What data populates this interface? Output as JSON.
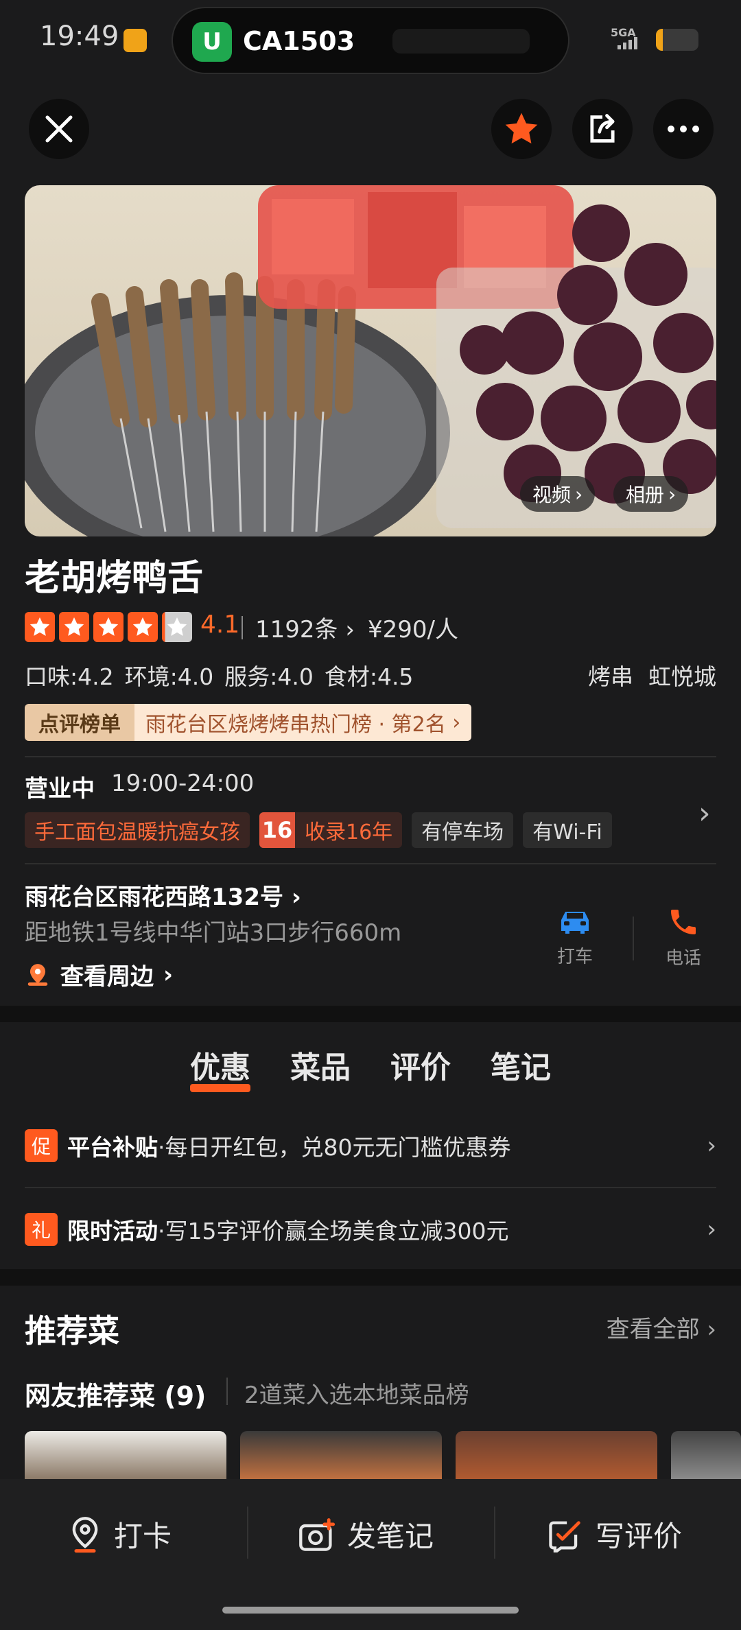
{
  "status_bar": {
    "time": "19:49",
    "signal": "5GA"
  },
  "dynamic_island": {
    "app_icon_glyph": "U",
    "text": "CA1503"
  },
  "hero": {
    "video_label": "视频",
    "album_label": "相册"
  },
  "shop": {
    "name": "老胡烤鸭舌",
    "rating": 4.1,
    "rating_text": "4.1",
    "review_count": "1192条",
    "price_per_person": "¥290/人",
    "scores": [
      "口味:4.2",
      "环境:4.0",
      "服务:4.0",
      "食材:4.5"
    ],
    "categories": [
      "烤串",
      "虹悦城"
    ],
    "ranking_tag": "点评榜单",
    "ranking_text": "雨花台区烧烤烤串热门榜 · 第2名"
  },
  "hours": {
    "status": "营业中",
    "time": "19:00-24:00"
  },
  "tags": {
    "charity": "手工面包温暖抗癌女孩",
    "years_badge": "16",
    "years_text": "收录16年",
    "parking": "有停车场",
    "wifi": "有Wi-Fi"
  },
  "location": {
    "address": "雨花台区雨花西路132号",
    "subway": "距地铁1号线中华门站3口步行660m",
    "nearby": "查看周边",
    "taxi_label": "打车",
    "phone_label": "电话"
  },
  "tabs": [
    "优惠",
    "菜品",
    "评价",
    "笔记"
  ],
  "promos": [
    {
      "icon": "促",
      "title": "平台补贴",
      "text": "·每日开红包，兑80元无门槛优惠券"
    },
    {
      "icon": "礼",
      "title": "限时活动",
      "text": "·写15字评价赢全场美食立减300元"
    }
  ],
  "recommend": {
    "title": "推荐菜",
    "see_all": "查看全部",
    "subtitle": "网友推荐菜 (9)",
    "subtitle2": "2道菜入选本地菜品榜"
  },
  "bottom_bar": {
    "checkin": "打卡",
    "post_note": "发笔记",
    "write_review": "写评价"
  },
  "colors": {
    "accent": "#ff5a1f",
    "background": "#1b1b1c"
  }
}
